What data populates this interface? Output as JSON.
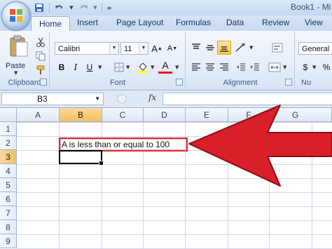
{
  "window": {
    "title": "Book1 - Mi"
  },
  "tabs": [
    "Home",
    "Insert",
    "Page Layout",
    "Formulas",
    "Data",
    "Review",
    "View"
  ],
  "ribbon": {
    "clipboard": {
      "paste_label": "Paste",
      "group_label": "Clipboard"
    },
    "font": {
      "font_name": "Calibri",
      "font_size": "11",
      "group_label": "Font",
      "grow": "A",
      "shrink": "A",
      "bold": "B",
      "italic": "I",
      "underline": "U",
      "font_color_glyph": "A"
    },
    "alignment": {
      "group_label": "Alignment"
    },
    "number": {
      "format": "General",
      "group_label": "Nu",
      "currency": "$",
      "percent": "%"
    }
  },
  "formula_bar": {
    "name_box": "B3",
    "fx_label": "fx",
    "value": ""
  },
  "columns": [
    "A",
    "B",
    "C",
    "D",
    "E",
    "F",
    "G"
  ],
  "rows": [
    "1",
    "2",
    "3",
    "4",
    "5",
    "6",
    "7",
    "8",
    "9"
  ],
  "selected": {
    "column": "B",
    "row": "3"
  },
  "cells": {
    "B2": "A is less than or equal to 100"
  },
  "colors": {
    "accent_red": "#d62b34",
    "ribbon_blue": "#dbe8f8",
    "selected_header": "#f6cf7e"
  }
}
